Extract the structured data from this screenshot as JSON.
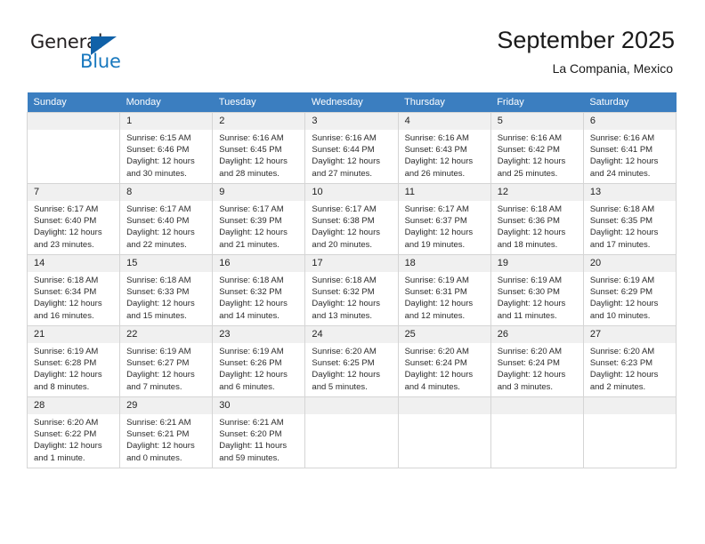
{
  "brand": {
    "name_line1": "General",
    "name_line2": "Blue",
    "triangle_color": "#1061a8",
    "blue_color": "#1878be"
  },
  "header": {
    "title": "September 2025",
    "subtitle": "La Compania, Mexico"
  },
  "theme": {
    "header_row_bg": "#3b7ec0",
    "header_row_text": "#ffffff",
    "daynum_bg": "#f0f0f0",
    "cell_border": "#d5d5d5",
    "body_text": "#2b2b2b"
  },
  "weekday_headers": [
    "Sunday",
    "Monday",
    "Tuesday",
    "Wednesday",
    "Thursday",
    "Friday",
    "Saturday"
  ],
  "labels": {
    "sunrise": "Sunrise:",
    "sunset": "Sunset:",
    "daylight": "Daylight:"
  },
  "weeks": [
    [
      {
        "day": "",
        "sunrise": "",
        "sunset": "",
        "daylight_a": "",
        "daylight_b": "",
        "empty": true
      },
      {
        "day": "1",
        "sunrise": "Sunrise: 6:15 AM",
        "sunset": "Sunset: 6:46 PM",
        "daylight_a": "Daylight: 12 hours",
        "daylight_b": "and 30 minutes."
      },
      {
        "day": "2",
        "sunrise": "Sunrise: 6:16 AM",
        "sunset": "Sunset: 6:45 PM",
        "daylight_a": "Daylight: 12 hours",
        "daylight_b": "and 28 minutes."
      },
      {
        "day": "3",
        "sunrise": "Sunrise: 6:16 AM",
        "sunset": "Sunset: 6:44 PM",
        "daylight_a": "Daylight: 12 hours",
        "daylight_b": "and 27 minutes."
      },
      {
        "day": "4",
        "sunrise": "Sunrise: 6:16 AM",
        "sunset": "Sunset: 6:43 PM",
        "daylight_a": "Daylight: 12 hours",
        "daylight_b": "and 26 minutes."
      },
      {
        "day": "5",
        "sunrise": "Sunrise: 6:16 AM",
        "sunset": "Sunset: 6:42 PM",
        "daylight_a": "Daylight: 12 hours",
        "daylight_b": "and 25 minutes."
      },
      {
        "day": "6",
        "sunrise": "Sunrise: 6:16 AM",
        "sunset": "Sunset: 6:41 PM",
        "daylight_a": "Daylight: 12 hours",
        "daylight_b": "and 24 minutes."
      }
    ],
    [
      {
        "day": "7",
        "sunrise": "Sunrise: 6:17 AM",
        "sunset": "Sunset: 6:40 PM",
        "daylight_a": "Daylight: 12 hours",
        "daylight_b": "and 23 minutes."
      },
      {
        "day": "8",
        "sunrise": "Sunrise: 6:17 AM",
        "sunset": "Sunset: 6:40 PM",
        "daylight_a": "Daylight: 12 hours",
        "daylight_b": "and 22 minutes."
      },
      {
        "day": "9",
        "sunrise": "Sunrise: 6:17 AM",
        "sunset": "Sunset: 6:39 PM",
        "daylight_a": "Daylight: 12 hours",
        "daylight_b": "and 21 minutes."
      },
      {
        "day": "10",
        "sunrise": "Sunrise: 6:17 AM",
        "sunset": "Sunset: 6:38 PM",
        "daylight_a": "Daylight: 12 hours",
        "daylight_b": "and 20 minutes."
      },
      {
        "day": "11",
        "sunrise": "Sunrise: 6:17 AM",
        "sunset": "Sunset: 6:37 PM",
        "daylight_a": "Daylight: 12 hours",
        "daylight_b": "and 19 minutes."
      },
      {
        "day": "12",
        "sunrise": "Sunrise: 6:18 AM",
        "sunset": "Sunset: 6:36 PM",
        "daylight_a": "Daylight: 12 hours",
        "daylight_b": "and 18 minutes."
      },
      {
        "day": "13",
        "sunrise": "Sunrise: 6:18 AM",
        "sunset": "Sunset: 6:35 PM",
        "daylight_a": "Daylight: 12 hours",
        "daylight_b": "and 17 minutes."
      }
    ],
    [
      {
        "day": "14",
        "sunrise": "Sunrise: 6:18 AM",
        "sunset": "Sunset: 6:34 PM",
        "daylight_a": "Daylight: 12 hours",
        "daylight_b": "and 16 minutes."
      },
      {
        "day": "15",
        "sunrise": "Sunrise: 6:18 AM",
        "sunset": "Sunset: 6:33 PM",
        "daylight_a": "Daylight: 12 hours",
        "daylight_b": "and 15 minutes."
      },
      {
        "day": "16",
        "sunrise": "Sunrise: 6:18 AM",
        "sunset": "Sunset: 6:32 PM",
        "daylight_a": "Daylight: 12 hours",
        "daylight_b": "and 14 minutes."
      },
      {
        "day": "17",
        "sunrise": "Sunrise: 6:18 AM",
        "sunset": "Sunset: 6:32 PM",
        "daylight_a": "Daylight: 12 hours",
        "daylight_b": "and 13 minutes."
      },
      {
        "day": "18",
        "sunrise": "Sunrise: 6:19 AM",
        "sunset": "Sunset: 6:31 PM",
        "daylight_a": "Daylight: 12 hours",
        "daylight_b": "and 12 minutes."
      },
      {
        "day": "19",
        "sunrise": "Sunrise: 6:19 AM",
        "sunset": "Sunset: 6:30 PM",
        "daylight_a": "Daylight: 12 hours",
        "daylight_b": "and 11 minutes."
      },
      {
        "day": "20",
        "sunrise": "Sunrise: 6:19 AM",
        "sunset": "Sunset: 6:29 PM",
        "daylight_a": "Daylight: 12 hours",
        "daylight_b": "and 10 minutes."
      }
    ],
    [
      {
        "day": "21",
        "sunrise": "Sunrise: 6:19 AM",
        "sunset": "Sunset: 6:28 PM",
        "daylight_a": "Daylight: 12 hours",
        "daylight_b": "and 8 minutes."
      },
      {
        "day": "22",
        "sunrise": "Sunrise: 6:19 AM",
        "sunset": "Sunset: 6:27 PM",
        "daylight_a": "Daylight: 12 hours",
        "daylight_b": "and 7 minutes."
      },
      {
        "day": "23",
        "sunrise": "Sunrise: 6:19 AM",
        "sunset": "Sunset: 6:26 PM",
        "daylight_a": "Daylight: 12 hours",
        "daylight_b": "and 6 minutes."
      },
      {
        "day": "24",
        "sunrise": "Sunrise: 6:20 AM",
        "sunset": "Sunset: 6:25 PM",
        "daylight_a": "Daylight: 12 hours",
        "daylight_b": "and 5 minutes."
      },
      {
        "day": "25",
        "sunrise": "Sunrise: 6:20 AM",
        "sunset": "Sunset: 6:24 PM",
        "daylight_a": "Daylight: 12 hours",
        "daylight_b": "and 4 minutes."
      },
      {
        "day": "26",
        "sunrise": "Sunrise: 6:20 AM",
        "sunset": "Sunset: 6:24 PM",
        "daylight_a": "Daylight: 12 hours",
        "daylight_b": "and 3 minutes."
      },
      {
        "day": "27",
        "sunrise": "Sunrise: 6:20 AM",
        "sunset": "Sunset: 6:23 PM",
        "daylight_a": "Daylight: 12 hours",
        "daylight_b": "and 2 minutes."
      }
    ],
    [
      {
        "day": "28",
        "sunrise": "Sunrise: 6:20 AM",
        "sunset": "Sunset: 6:22 PM",
        "daylight_a": "Daylight: 12 hours",
        "daylight_b": "and 1 minute."
      },
      {
        "day": "29",
        "sunrise": "Sunrise: 6:21 AM",
        "sunset": "Sunset: 6:21 PM",
        "daylight_a": "Daylight: 12 hours",
        "daylight_b": "and 0 minutes."
      },
      {
        "day": "30",
        "sunrise": "Sunrise: 6:21 AM",
        "sunset": "Sunset: 6:20 PM",
        "daylight_a": "Daylight: 11 hours",
        "daylight_b": "and 59 minutes."
      },
      {
        "day": "",
        "sunrise": "",
        "sunset": "",
        "daylight_a": "",
        "daylight_b": "",
        "empty": true
      },
      {
        "day": "",
        "sunrise": "",
        "sunset": "",
        "daylight_a": "",
        "daylight_b": "",
        "empty": true
      },
      {
        "day": "",
        "sunrise": "",
        "sunset": "",
        "daylight_a": "",
        "daylight_b": "",
        "empty": true
      },
      {
        "day": "",
        "sunrise": "",
        "sunset": "",
        "daylight_a": "",
        "daylight_b": "",
        "empty": true
      }
    ]
  ]
}
